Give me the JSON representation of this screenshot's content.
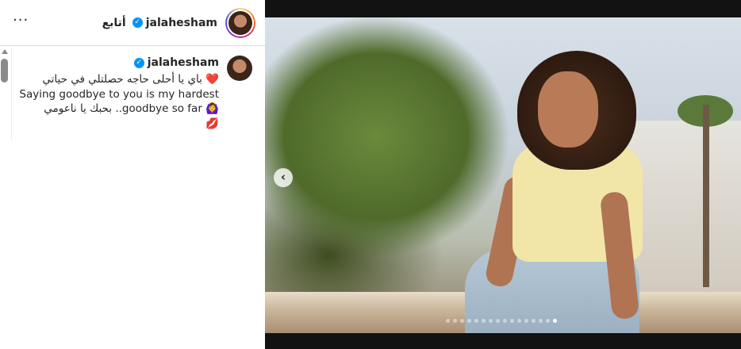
{
  "header": {
    "username": "jalahesham",
    "follow_label": "أتابع",
    "more_label": "···",
    "verified_mark": "✓"
  },
  "caption": {
    "username": "jalahesham",
    "verified_mark": "✓",
    "lines": [
      "❤️ باي يا أحلى حاجه حصلتلي في حياتي",
      "Saying goodbye to you is my hardest",
      "🙆‍♀️ goodbye so far.. بحبك يا ناعومي",
      "💋"
    ]
  },
  "media": {
    "prev_arrow": "‹",
    "carousel_count": 16,
    "carousel_active_index": 15
  },
  "icons": {
    "verified": "verified-badge-icon",
    "more": "more-options-icon",
    "prev": "chevron-left-icon"
  },
  "colors": {
    "verified": "#0095f6",
    "text": "#262626",
    "border": "#dbdbdb",
    "media_bg": "#121212"
  }
}
